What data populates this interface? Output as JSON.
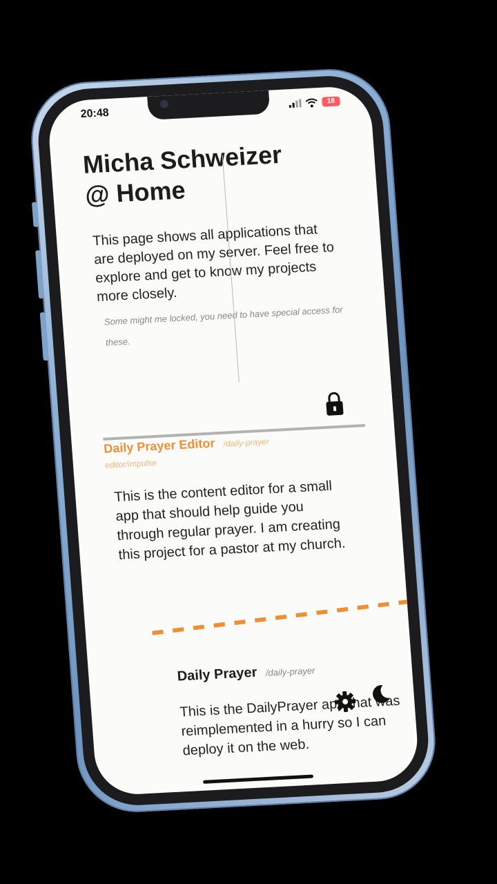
{
  "status_bar": {
    "time": "20:48",
    "battery_level": "18",
    "battery_color": "#ff5a5f"
  },
  "header": {
    "title_line1": "Micha Schweizer",
    "title_line2": "@ Home"
  },
  "intro": {
    "text": "This page shows all applications that are deployed on my server. Feel free to explore and get to know my projects more closely.",
    "note": "Some might me locked, you need to have special access for these."
  },
  "apps": [
    {
      "name": "Daily Prayer Editor",
      "path": "/daily-prayer",
      "subpath": "editor/impulse",
      "description": "This is the content editor for a small app that should help guide you through regular prayer. I am creating this project for a pastor at my church.",
      "locked": true,
      "accent_color": "#ef8f35"
    },
    {
      "name": "Daily Prayer",
      "path": "/daily-prayer",
      "description": "This is the DailyPrayer app that was reimplemented in a hurry so I can deploy it on the web."
    }
  ],
  "colors": {
    "accent": "#ef8f35",
    "frame": "#8fb1d6",
    "screen_bg": "#fbfbfa"
  },
  "icons": {
    "lock": "lock-icon",
    "settings": "gear-icon",
    "theme": "moon-icon"
  }
}
